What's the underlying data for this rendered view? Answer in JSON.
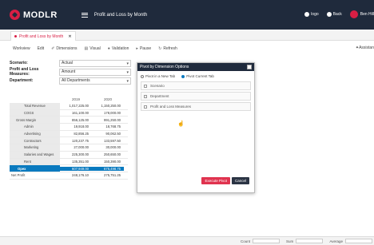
{
  "header": {
    "logo_text": "MODLR",
    "title": "Profit and Loss by Month",
    "logo_label": "logo",
    "back_label": "Back",
    "user_name": "Ben Hill"
  },
  "tab": {
    "label": "Profit and Loss by Month",
    "close": "✕"
  },
  "toolbar": {
    "items": [
      "Workview",
      "Edit",
      "Dimensions",
      "Visual",
      "Validation",
      "Pause",
      "Refresh"
    ],
    "assist_label": "Assistan"
  },
  "filters": [
    {
      "label": "Scenario:",
      "value": "Actual"
    },
    {
      "label": "Profit and Loss Measures:",
      "value": "Amount"
    },
    {
      "label": "Department:",
      "value": "All Departments"
    }
  ],
  "grid": {
    "columns": [
      "2019",
      "2020"
    ],
    "rows": [
      {
        "label": "Total Revenue",
        "v": [
          "1,017,225.00",
          "1,150,250.00"
        ]
      },
      {
        "label": "COGS",
        "v": [
          "161,100.00",
          "178,000.00"
        ]
      },
      {
        "label": "Gross Margin",
        "v": [
          "856,125.00",
          "991,250.00"
        ]
      },
      {
        "label": "Admin",
        "v": [
          "19,918.00",
          "18,768.75"
        ]
      },
      {
        "label": "Advertising",
        "v": [
          "82,856.25",
          "90,062.50"
        ]
      },
      {
        "label": "Contractors",
        "v": [
          "120,237.75",
          "133,597.50"
        ]
      },
      {
        "label": "Marketing",
        "v": [
          "27,000.00",
          "30,000.00"
        ]
      },
      {
        "label": "Salaries and Wages",
        "v": [
          "225,300.00",
          "250,650.00"
        ]
      },
      {
        "label": "Rent",
        "v": [
          "135,351.00",
          "150,390.00"
        ]
      },
      {
        "label": "Opex",
        "v": [
          "607,949.00",
          "675,498.75"
        ]
      },
      {
        "label": "Net Profit",
        "v": [
          "248,176.10",
          "275,751.25"
        ]
      }
    ]
  },
  "dialog": {
    "title": "Pivot by Dimension Options",
    "radio_new_tab": "Pivot in a New Tab",
    "radio_current_tab": "Pivot Current Tab",
    "dimensions": [
      "Scenario",
      "Department",
      "Profit and Loss Measures"
    ],
    "execute_label": "Execute Pivot",
    "cancel_label": "Cancel",
    "cursor_glyph": "☝"
  },
  "status": {
    "count_label": "Count",
    "sum_label": "Sum",
    "average_label": "Average"
  }
}
